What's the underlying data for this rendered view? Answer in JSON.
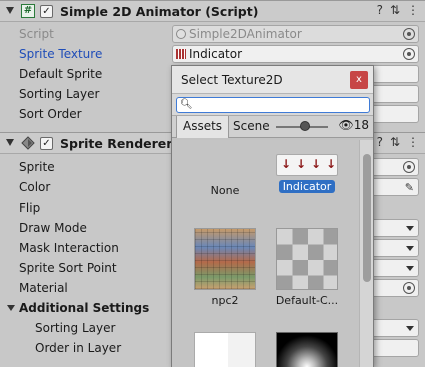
{
  "script_component": {
    "title": "Simple 2D Animator (Script)",
    "fields": [
      {
        "label": "Script",
        "value": "Simple2DAnimator"
      },
      {
        "label": "Sprite Texture",
        "value": "Indicator"
      },
      {
        "label": "Default Sprite",
        "value": ""
      },
      {
        "label": "Sorting Layer",
        "value": ""
      },
      {
        "label": "Sort Order",
        "value": ""
      }
    ]
  },
  "sprite_renderer": {
    "title": "Sprite Renderer",
    "fields": [
      {
        "label": "Sprite"
      },
      {
        "label": "Color"
      },
      {
        "label": "Flip"
      },
      {
        "label": "Draw Mode"
      },
      {
        "label": "Mask Interaction"
      },
      {
        "label": "Sprite Sort Point"
      },
      {
        "label": "Material"
      }
    ],
    "additional": {
      "label": "Additional Settings",
      "fields": [
        {
          "label": "Sorting Layer"
        },
        {
          "label": "Order in Layer"
        }
      ]
    }
  },
  "popup": {
    "title": "Select Texture2D",
    "close": "x",
    "search_value": "",
    "tabs": [
      "Assets",
      "Scene"
    ],
    "hidden_count": "18",
    "items": [
      {
        "name": "None",
        "selected": false
      },
      {
        "name": "Indicator",
        "selected": true
      },
      {
        "name": "npc2",
        "selected": false
      },
      {
        "name": "Default-C...",
        "selected": false
      }
    ]
  },
  "icons": {
    "help": "help-icon",
    "settings": "sliders-icon",
    "menu": "kebab-icon",
    "hidden": "eye-slash-icon",
    "search": "search-icon"
  }
}
